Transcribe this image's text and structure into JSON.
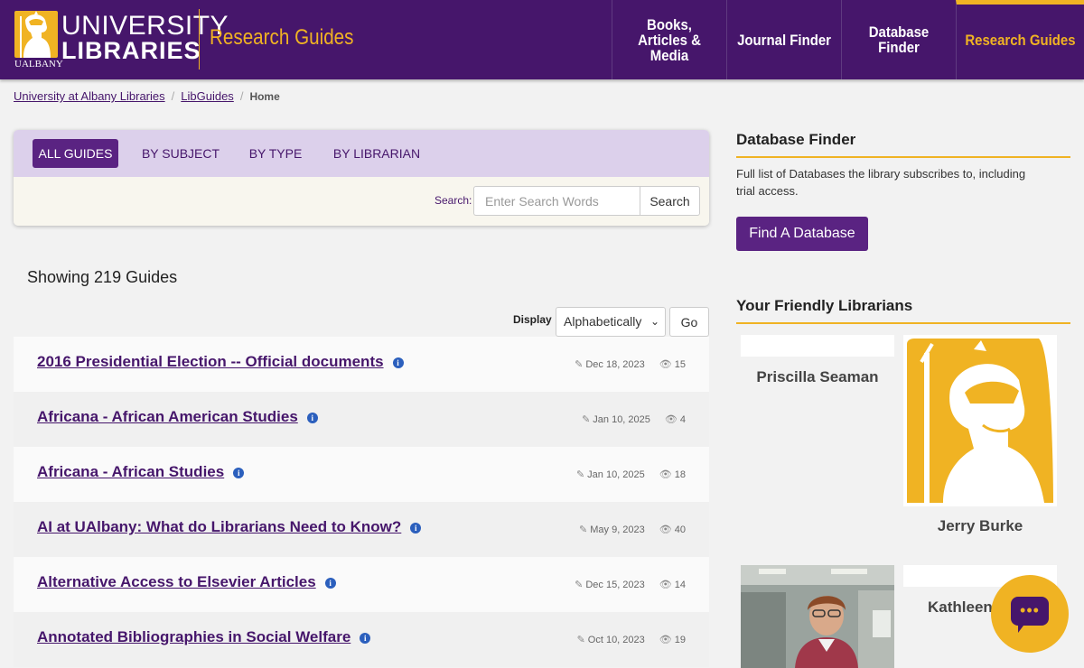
{
  "header": {
    "logo_line1": "UNIVERSITY",
    "logo_line2": "LIBRARIES",
    "logo_sub": "UALBANY",
    "site_title": "Research Guides",
    "nav": [
      {
        "label": "Books, Articles & Media"
      },
      {
        "label": "Journal Finder"
      },
      {
        "label": "Database Finder"
      },
      {
        "label": "Research Guides"
      }
    ],
    "active_nav": "Research Guides"
  },
  "breadcrumb": [
    {
      "label": "University at Albany Libraries"
    },
    {
      "label": "LibGuides"
    },
    {
      "label": "Home"
    }
  ],
  "tabs": [
    {
      "label": "ALL GUIDES",
      "active": true
    },
    {
      "label": "BY SUBJECT",
      "active": false
    },
    {
      "label": "BY TYPE",
      "active": false
    },
    {
      "label": "BY LIBRARIAN",
      "active": false
    }
  ],
  "search": {
    "label": "Search:",
    "placeholder": "Enter Search Words",
    "value": "",
    "button": "Search"
  },
  "showing": "Showing 219 Guides",
  "display": {
    "label": "Display",
    "selected": "Alphabetically",
    "go": "Go"
  },
  "guides": [
    {
      "title": "2016 Presidential Election -- Official documents",
      "date": "Dec 18, 2023",
      "views": "15"
    },
    {
      "title": "Africana - African American Studies",
      "date": "Jan 10, 2025",
      "views": "4"
    },
    {
      "title": "Africana - African Studies",
      "date": "Jan 10, 2025",
      "views": "18"
    },
    {
      "title": "AI at UAlbany: What do Librarians Need to Know?",
      "date": "May 9, 2023",
      "views": "40"
    },
    {
      "title": "Alternative Access to Elsevier Articles",
      "date": "Dec 15, 2023",
      "views": "14"
    },
    {
      "title": "Annotated Bibliographies in Social Welfare",
      "date": "Oct 10, 2023",
      "views": "19"
    }
  ],
  "sidebar": {
    "database_finder": {
      "heading": "Database Finder",
      "description": "Full list of Databases the library subscribes to, including trial access.",
      "button": "Find A Database"
    },
    "librarians": {
      "heading": "Your Friendly Librarians",
      "people": [
        {
          "name": "Priscilla Seaman"
        },
        {
          "name": "Jerry Burke"
        },
        {
          "name": ""
        },
        {
          "name": "Kathleen"
        }
      ]
    }
  },
  "colors": {
    "purple": "#46166b",
    "gold": "#f0b323",
    "tab_bg": "#dcd0eb",
    "button_purple": "#5a2382"
  }
}
